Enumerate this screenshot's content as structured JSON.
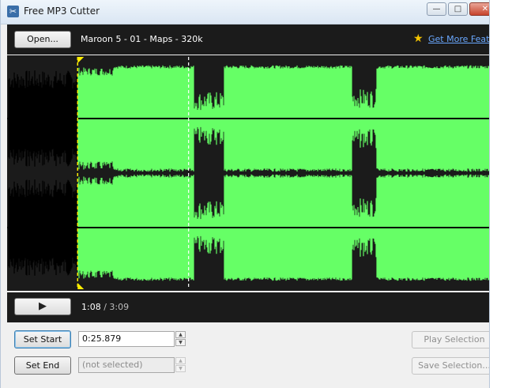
{
  "window": {
    "title": "Free MP3 Cutter",
    "minimize_glyph": "—",
    "maximize_glyph": "□"
  },
  "toolbar": {
    "open_label": "Open...",
    "track_name": "Maroon 5 - 01 - Maps - 320k",
    "star_icon": "★",
    "feature_link": "Get More Features"
  },
  "colors": {
    "waveform_selected": "#66ff66",
    "waveform_unselected": "#000000",
    "panel_background": "#1b1b1b",
    "start_marker": "#ffee00",
    "position_marker": "#ffffff"
  },
  "playback": {
    "play_icon": "▶",
    "current_time": "1:08",
    "separator": " / ",
    "total_time": "3:09",
    "duration_seconds": 189,
    "selection_start_seconds": 25.879,
    "position_seconds": 68
  },
  "controls": {
    "set_start_label": "Set Start",
    "start_value": "0:25.879",
    "set_end_label": "Set End",
    "end_placeholder": "(not selected)",
    "play_selection_label": "Play Selection",
    "save_selection_label": "Save Selection..."
  }
}
